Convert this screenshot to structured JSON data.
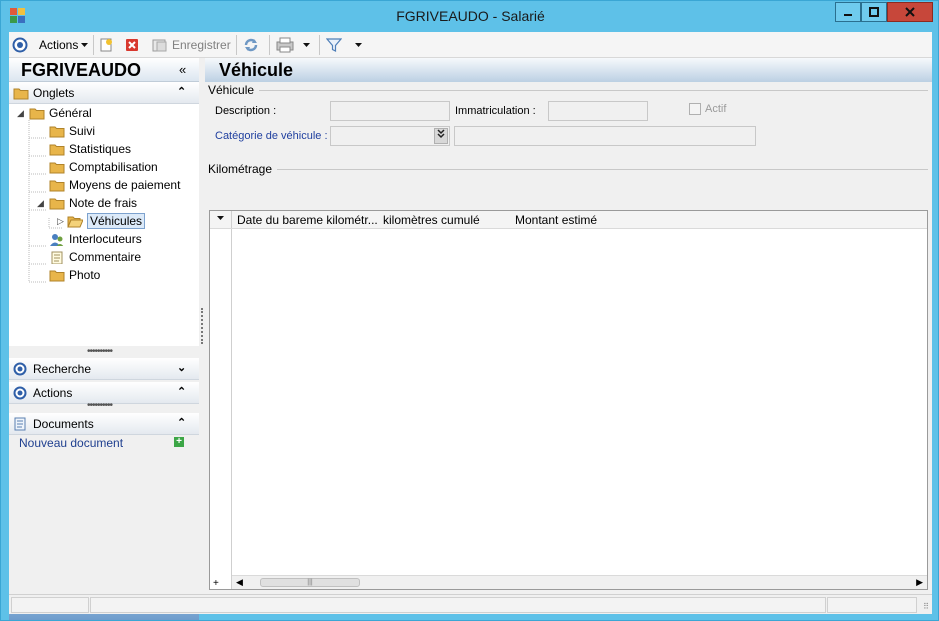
{
  "window": {
    "title": "FGRIVEAUDO -  Salarié",
    "accent": "#5ec1e8",
    "close_color": "#c7473a"
  },
  "toolbar": {
    "actions_label": "Actions",
    "save_label": "Enregistrer"
  },
  "left": {
    "record_name": "FGRIVEAUDO",
    "tabs_section": "Onglets",
    "tree": {
      "root": "Général",
      "items": [
        "Suivi",
        "Statistiques",
        "Comptabilisation",
        "Moyens de paiement"
      ],
      "note_frais": "Note de frais",
      "vehicules": "Véhicules",
      "after": [
        "Interlocuteurs",
        "Commentaire",
        "Photo"
      ]
    },
    "search_section": "Recherche",
    "actions_section": "Actions",
    "documents_section": "Documents",
    "new_document": "Nouveau document"
  },
  "main": {
    "title": "Véhicule",
    "group_vehicle": "Véhicule",
    "description_label": "Description :",
    "description_value": "",
    "registration_label": "Immatriculation :",
    "registration_value": "",
    "active_label": "Actif",
    "active_checked": false,
    "category_label": "Catégorie de véhicule :",
    "category_value": "",
    "category_desc_value": "",
    "group_mileage": "Kilométrage",
    "grid": {
      "columns": [
        "Date du bareme kilométr...",
        "kilomètres cumulé",
        "Montant estimé"
      ],
      "rows": []
    }
  }
}
